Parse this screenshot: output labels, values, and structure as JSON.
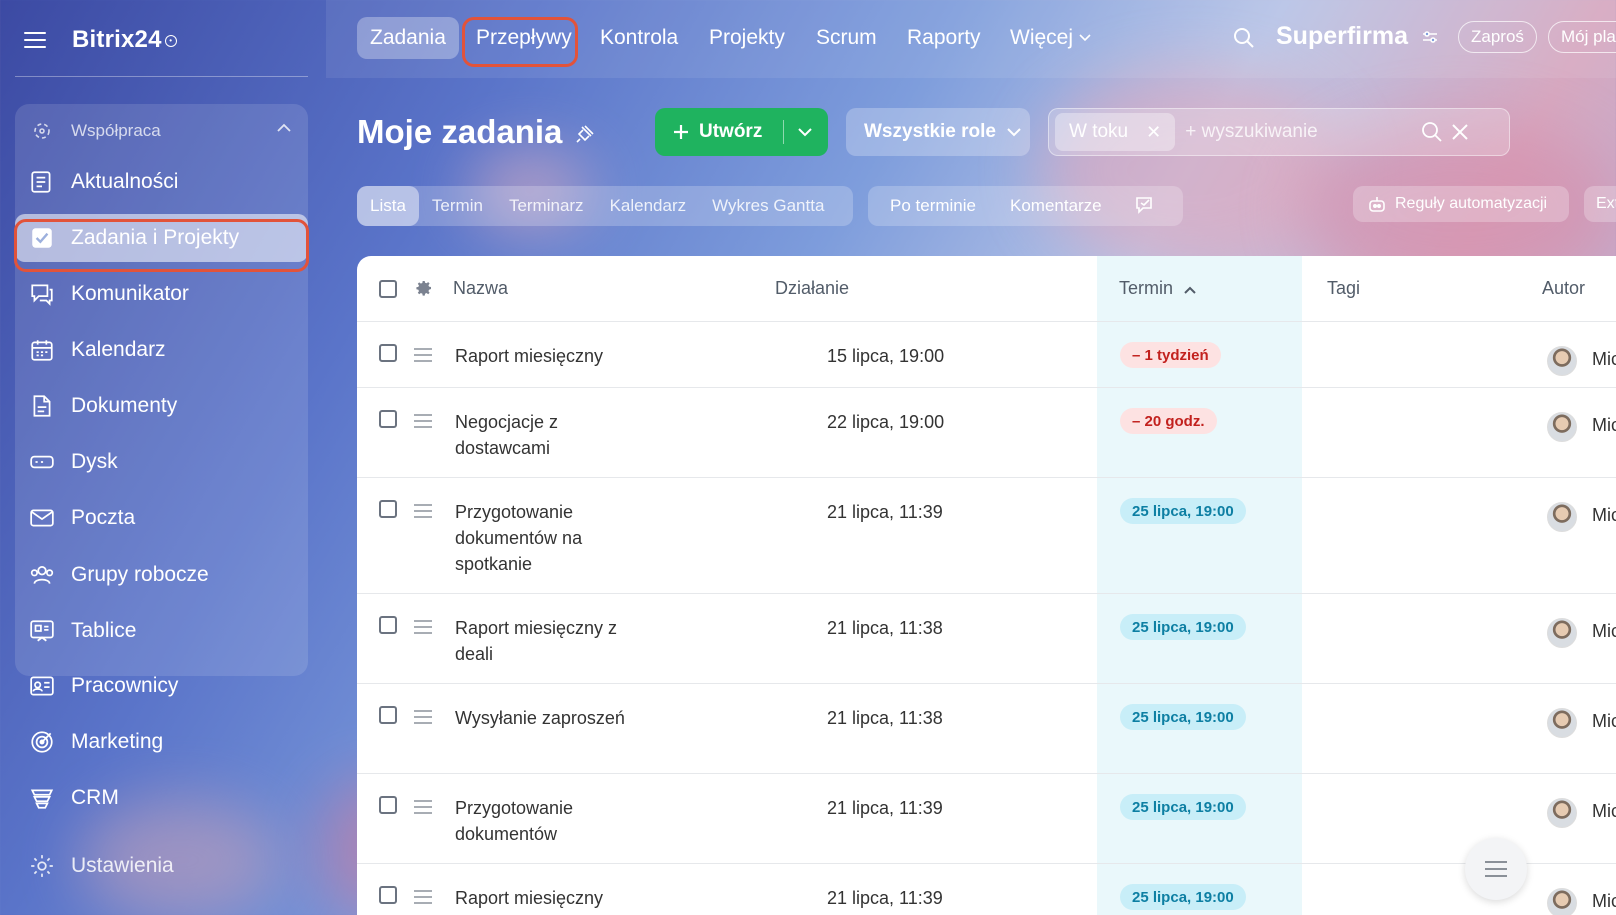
{
  "sidebar": {
    "logo": "Bitrix24",
    "group_title": "Współpraca",
    "items": [
      {
        "label": "Aktualności",
        "icon": "news-icon"
      },
      {
        "label": "Zadania i Projekty",
        "icon": "task-check-icon",
        "active": true
      },
      {
        "label": "Komunikator",
        "icon": "chat-icon"
      },
      {
        "label": "Kalendarz",
        "icon": "calendar-icon"
      },
      {
        "label": "Dokumenty",
        "icon": "document-icon"
      },
      {
        "label": "Dysk",
        "icon": "drive-icon"
      },
      {
        "label": "Poczta",
        "icon": "mail-icon"
      },
      {
        "label": "Grupy robocze",
        "icon": "group-icon"
      },
      {
        "label": "Tablice",
        "icon": "board-icon"
      }
    ],
    "extra_items": [
      {
        "label": "Pracownicy",
        "icon": "employees-icon"
      },
      {
        "label": "Marketing",
        "icon": "marketing-icon"
      },
      {
        "label": "CRM",
        "icon": "crm-icon"
      },
      {
        "label": "Ustawienia",
        "icon": "settings-icon"
      }
    ]
  },
  "topnav": {
    "tabs": [
      "Zadania",
      "Przepływy",
      "Kontrola",
      "Projekty",
      "Scrum",
      "Raporty",
      "Więcej"
    ],
    "company": "Superfirma",
    "invite_label": "Zaproś",
    "plan_label": "Mój pla"
  },
  "header": {
    "title": "Moje zadania",
    "create_label": "Utwórz",
    "roles_label": "Wszystkie role",
    "filter_chip": "W toku",
    "search_placeholder": "+ wyszukiwanie"
  },
  "views": {
    "tabs": [
      "Lista",
      "Termin",
      "Terminarz",
      "Kalendarz",
      "Wykres Gantta"
    ],
    "sort": [
      "Po terminie",
      "Komentarze"
    ],
    "automation_label": "Reguły automatyzacji",
    "ext_label": "Ext"
  },
  "table": {
    "columns": {
      "name": "Nazwa",
      "action": "Działanie",
      "deadline": "Termin",
      "tags": "Tagi",
      "author": "Autor"
    },
    "rows": [
      {
        "name": "Raport miesięczny",
        "action": "15 lipca, 19:00",
        "deadline": "– 1 tydzień",
        "status": "overdue",
        "author": "Mic"
      },
      {
        "name": "Negocjacje z dostawcami",
        "action": "22 lipca, 19:00",
        "deadline": "– 20 godz.",
        "status": "overdue",
        "author": "Mic"
      },
      {
        "name": "Przygotowanie dokumentów na spotkanie",
        "action": "21 lipca, 11:39",
        "deadline": "25 lipca, 19:00",
        "status": "ok",
        "author": "Mic"
      },
      {
        "name": "Raport miesięczny z deali",
        "action": "21 lipca, 11:38",
        "deadline": "25 lipca, 19:00",
        "status": "ok",
        "author": "Mic"
      },
      {
        "name": "Wysyłanie zaproszeń",
        "action": "21 lipca, 11:38",
        "deadline": "25 lipca, 19:00",
        "status": "ok",
        "author": "Mic"
      },
      {
        "name": "Przygotowanie dokumentów",
        "action": "21 lipca, 11:39",
        "deadline": "25 lipca, 19:00",
        "status": "ok",
        "author": "Mic"
      },
      {
        "name": "Raport miesięczny",
        "action": "21 lipca, 11:39",
        "deadline": "25 lipca, 19:00",
        "status": "ok",
        "author": "Mic"
      }
    ]
  },
  "colors": {
    "accent_green": "#1fb35f",
    "highlight": "#e2533a",
    "overdue": "#c2211e",
    "ok": "#0d7fa3"
  }
}
